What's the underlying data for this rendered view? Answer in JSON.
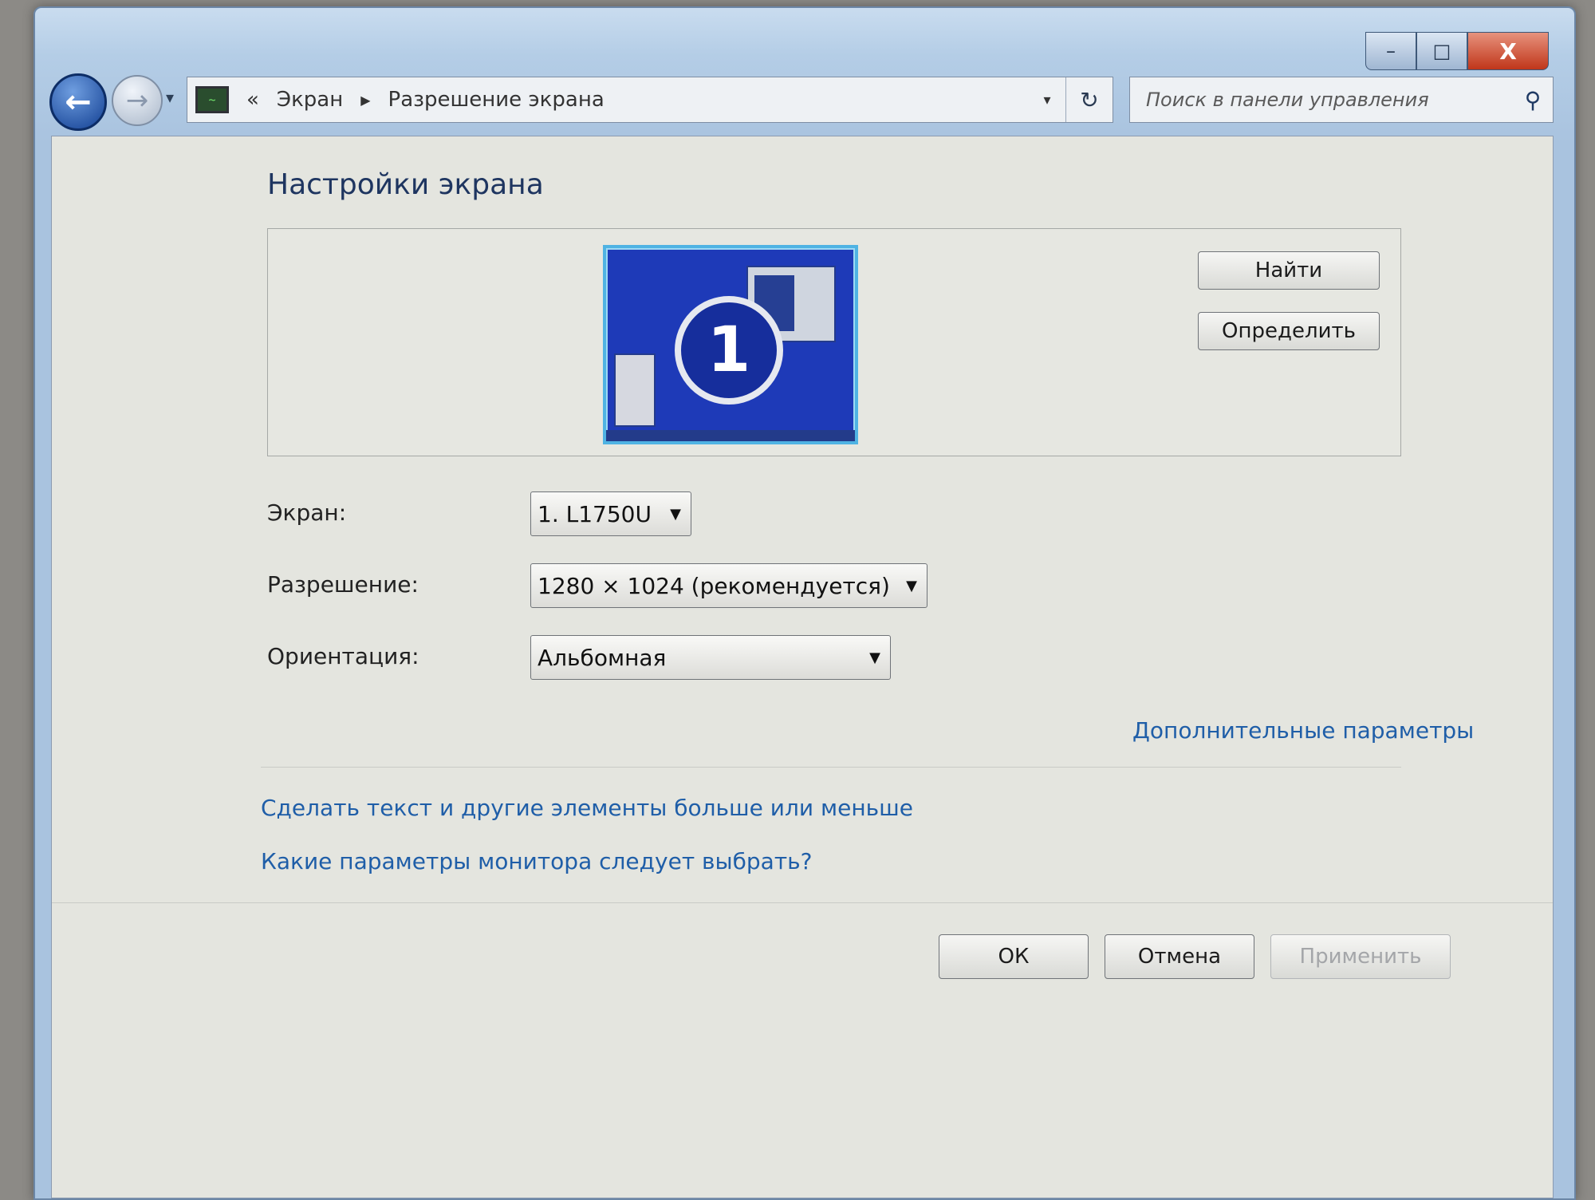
{
  "window": {
    "caption_buttons": {
      "minimize": "–",
      "maximize": "□",
      "close": "X"
    }
  },
  "navbar": {
    "back_icon": "arrow-left-icon",
    "forward_icon": "arrow-right-icon",
    "breadcrumb_sep": "«",
    "breadcrumb": [
      "Экран",
      "Разрешение экрана"
    ],
    "breadcrumb_arrow": "▶",
    "dropdown_arrow": "▾",
    "refresh": "↻",
    "search_placeholder": "Поиск в панели управления",
    "search_icon": "⚲"
  },
  "main": {
    "title": "Настройки экрана",
    "monitor_number": "1",
    "find_button": "Найти",
    "identify_button": "Определить",
    "display_label": "Экран:",
    "display_value": "1. L1750U",
    "resolution_label": "Разрешение:",
    "resolution_value": "1280 × 1024 (рекомендуется)",
    "orientation_label": "Ориентация:",
    "orientation_value": "Альбомная",
    "advanced_link": "Дополнительные параметры",
    "text_size_link": "Сделать текст и другие элементы больше или меньше",
    "which_settings_link": "Какие параметры монитора следует выбрать?",
    "select_arrow": "▼"
  },
  "footer": {
    "ok": "ОК",
    "cancel": "Отмена",
    "apply": "Применить"
  },
  "colors": {
    "link": "#1f5ea8",
    "title": "#1e3560",
    "monitor_blue": "#1e3ab8"
  }
}
